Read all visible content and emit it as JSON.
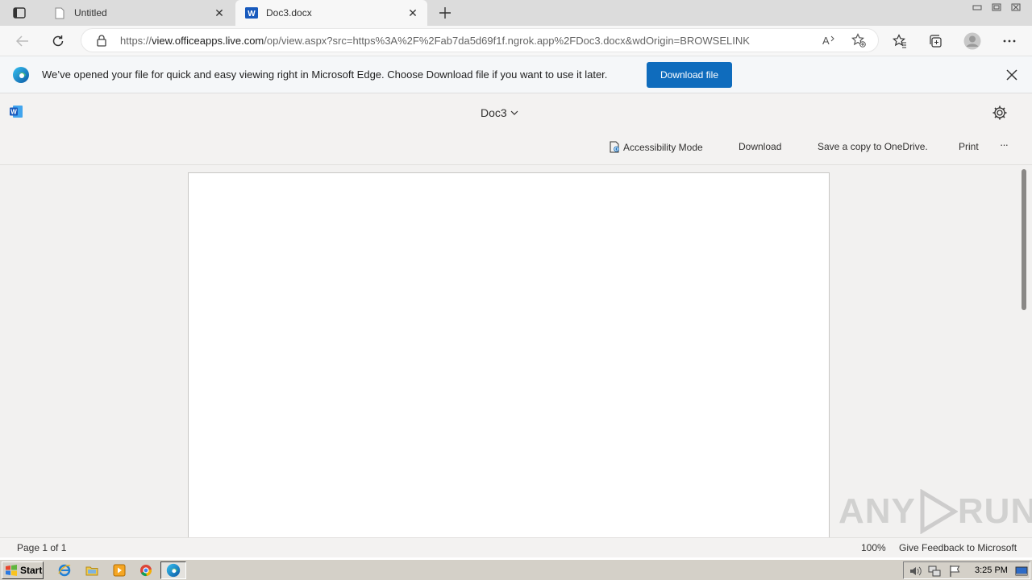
{
  "browser": {
    "tabs": [
      {
        "title": "Untitled",
        "active": false
      },
      {
        "title": "Doc3.docx",
        "active": true
      }
    ],
    "address": {
      "url_prefix": "https://",
      "url_domain": "view.officeapps.live.com",
      "url_path": "/op/view.aspx?src=https%3A%2F%2Fab7da5d69f1f.ngrok.app%2FDoc3.docx&wdOrigin=BROWSELINK"
    }
  },
  "infobar": {
    "message": "We’ve opened your file for quick and easy viewing right in Microsoft Edge. Choose Download file if you want to use it later.",
    "button_label": "Download file"
  },
  "viewer": {
    "doc_title": "Doc3",
    "commands": {
      "accessibility": "Accessibility Mode",
      "download": "Download",
      "save_copy": "Save a copy to OneDrive.",
      "print": "Print",
      "more": "···"
    }
  },
  "status": {
    "page": "Page 1 of 1",
    "zoom": "100%",
    "feedback": "Give Feedback to Microsoft"
  },
  "watermark": {
    "text_left": "ANY",
    "text_right": "RUN"
  },
  "taskbar": {
    "start_label": "Start",
    "clock": "3:25 PM"
  },
  "colors": {
    "accent_blue": "#0f6cbd",
    "word_blue": "#185abd"
  }
}
